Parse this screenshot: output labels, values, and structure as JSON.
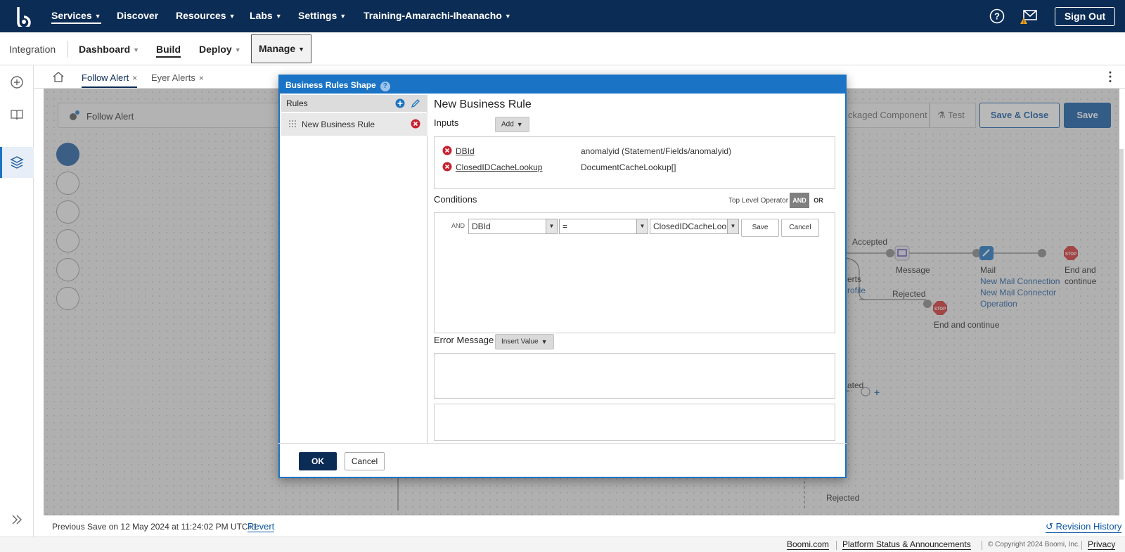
{
  "topnav": {
    "items": [
      {
        "label": "Services",
        "caret": true
      },
      {
        "label": "Discover",
        "caret": false
      },
      {
        "label": "Resources",
        "caret": true
      },
      {
        "label": "Labs",
        "caret": true
      },
      {
        "label": "Settings",
        "caret": true
      },
      {
        "label": "Training-Amarachi-Iheanacho",
        "caret": true
      }
    ],
    "sign_out": "Sign Out",
    "icons": [
      "help-icon",
      "mail-icon",
      "warning-icon"
    ]
  },
  "subnav": {
    "integration": "Integration",
    "dashboard": "Dashboard",
    "build": "Build",
    "deploy": "Deploy",
    "manage": "Manage"
  },
  "tabs": [
    {
      "label": "Follow Alert",
      "active": true,
      "close": "×"
    },
    {
      "label": "Eyer Alerts",
      "active": false,
      "close": "×"
    }
  ],
  "process": {
    "name": "Follow Alert",
    "packaged_component": "ckaged Component",
    "test": "Test",
    "save_close": "Save & Close",
    "save": "Save"
  },
  "flow": {
    "accepted": "Accepted",
    "rejected": "Rejected",
    "message": "Message",
    "mail": "Mail",
    "new_mail_connection": "New Mail Connection",
    "new_mail_operation_1": "New Mail Connector",
    "new_mail_operation_2": "Operation",
    "end_continue_1": "End and",
    "end_continue_2": "continue",
    "end_continue_full": "End and continue",
    "erts": "erts",
    "rofile": "rofile",
    "ated": "ated",
    "rejected2": "Rejected"
  },
  "status": {
    "previous_save": "Previous Save on 12 May 2024 at 11:24:02 PM UTC+1",
    "revert": "Revert",
    "revision_history": "Revision History"
  },
  "footer": {
    "boomi": "Boomi.com",
    "platform": "Platform Status & Announcements",
    "copyright": "© Copyright 2024 Boomi, Inc.",
    "privacy": "Privacy"
  },
  "modal": {
    "title": "Business Rules Shape",
    "help": "?",
    "rules_header": "Rules",
    "rule_item": "New Business Rule",
    "detail_title": "New Business Rule",
    "inputs_label": "Inputs",
    "add_label": "Add",
    "inputs": [
      {
        "name": "DBId",
        "value": "anomalyid (Statement/Fields/anomalyid)"
      },
      {
        "name": "ClosedIDCacheLookup",
        "value": "DocumentCacheLookup[]"
      }
    ],
    "conditions_label": "Conditions",
    "top_level_operator": "Top Level Operator",
    "and": "AND",
    "or": "OR",
    "condition": {
      "and": "AND",
      "field": "DBId",
      "operator": "=",
      "value": "ClosedIDCacheLooki",
      "save": "Save",
      "cancel": "Cancel"
    },
    "error_message_label": "Error Message",
    "insert_value": "Insert Value",
    "ok": "OK",
    "cancel": "Cancel"
  },
  "colors": {
    "nav_bg": "#0b2c55",
    "accent": "#1a73c4",
    "primary_button": "#0b57a4",
    "error_icon": "#c8202f"
  }
}
